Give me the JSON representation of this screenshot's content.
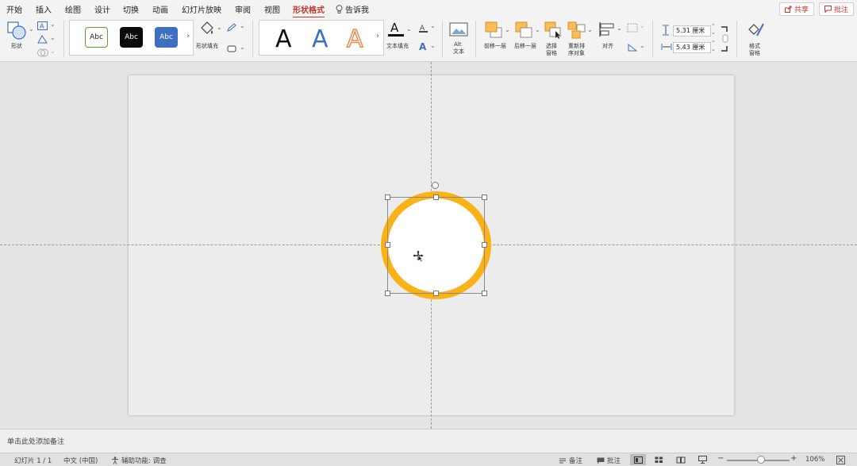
{
  "menu": {
    "tabs": [
      "开始",
      "插入",
      "绘图",
      "设计",
      "切换",
      "动画",
      "幻灯片放映",
      "审阅",
      "视图",
      "形状格式"
    ],
    "active_tab": "形状格式",
    "tell_me": "告诉我",
    "share_label": "共享",
    "comments_label": "批注"
  },
  "ribbon": {
    "shape_label": "形状",
    "style_samples": [
      "Abc",
      "Abc",
      "Abc"
    ],
    "shape_fill_label": "形状填充",
    "wordart_glyph": "A",
    "text_fill_label": "文本填充",
    "alt_text_label_1": "Alt",
    "alt_text_label_2": "文本",
    "bring_forward_label": "前移一层",
    "send_backward_label": "后移一层",
    "selection_pane_label_1": "选择",
    "selection_pane_label_2": "窗格",
    "reorder_label_1": "重新排",
    "reorder_label_2": "序对象",
    "align_label": "对齐",
    "height_value": "5.31 厘米",
    "width_value": "5.43 厘米",
    "format_pane_label_1": "格式",
    "format_pane_label_2": "窗格"
  },
  "colors": {
    "accent": "#c1372a",
    "circle_outline": "#fbb216",
    "style_blue": "#3f6fc1",
    "wordart_blue": "#3f6fc1",
    "wordart_orange": "#e98a4e"
  },
  "notes": {
    "placeholder": "单击此处添加备注"
  },
  "status": {
    "slide_count": "幻灯片 1 / 1",
    "language": "中文 (中国)",
    "accessibility": "辅助功能: 调查",
    "notes_label": "备注",
    "comments_label": "批注",
    "zoom": "106%",
    "zoom_fraction": 0.55
  }
}
